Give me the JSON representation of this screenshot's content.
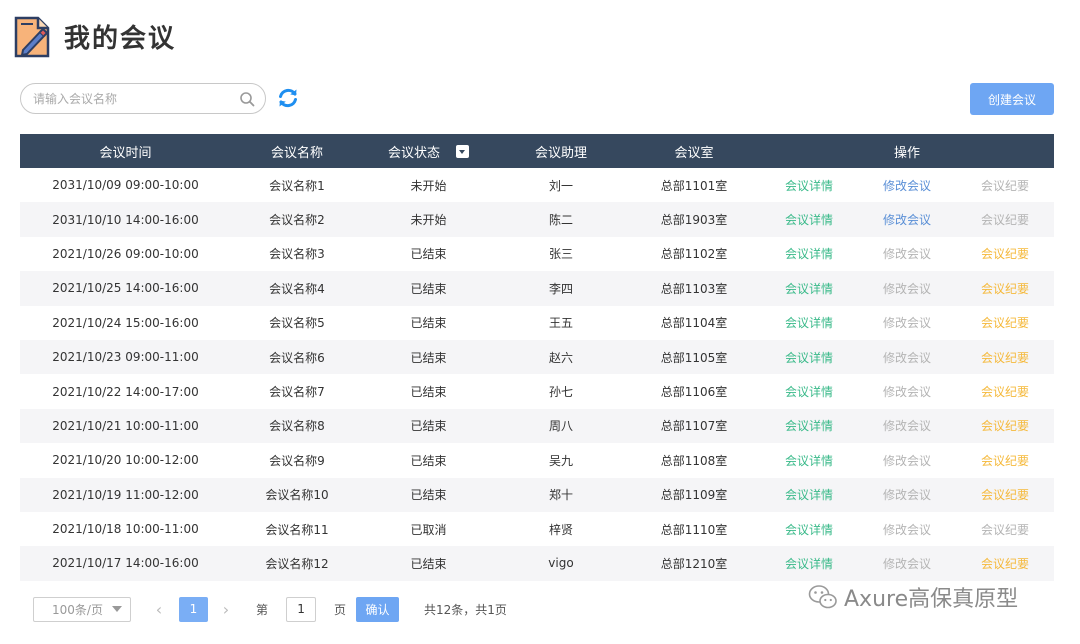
{
  "page": {
    "title": "我的会议"
  },
  "search": {
    "placeholder": "请输入会议名称"
  },
  "actions": {
    "create_label": "创建会议"
  },
  "colors": {
    "header_bg": "#36485e",
    "link_green": "#3aba8a",
    "link_blue": "#5a8fd6",
    "link_gray": "#b4b4b4",
    "link_orange": "#f5b93b",
    "primary": "#6ea6f3"
  },
  "table": {
    "headers": [
      "会议时间",
      "会议名称",
      "会议状态",
      "会议助理",
      "会议室",
      "操作"
    ],
    "rows": [
      {
        "time": "2031/10/09 09:00-10:00",
        "name": "会议名称1",
        "status": "未开始",
        "assistant": "刘一",
        "room": "总部1101室",
        "detail": "会议详情",
        "detail_state": "green",
        "edit": "修改会议",
        "edit_state": "blue",
        "minutes": "会议纪要",
        "minutes_state": "gray"
      },
      {
        "time": "2031/10/10 14:00-16:00",
        "name": "会议名称2",
        "status": "未开始",
        "assistant": "陈二",
        "room": "总部1903室",
        "detail": "会议详情",
        "detail_state": "green",
        "edit": "修改会议",
        "edit_state": "blue",
        "minutes": "会议纪要",
        "minutes_state": "gray"
      },
      {
        "time": "2021/10/26 09:00-10:00",
        "name": "会议名称3",
        "status": "已结束",
        "assistant": "张三",
        "room": "总部1102室",
        "detail": "会议详情",
        "detail_state": "green",
        "edit": "修改会议",
        "edit_state": "gray",
        "minutes": "会议纪要",
        "minutes_state": "orange"
      },
      {
        "time": "2021/10/25 14:00-16:00",
        "name": "会议名称4",
        "status": "已结束",
        "assistant": "李四",
        "room": "总部1103室",
        "detail": "会议详情",
        "detail_state": "green",
        "edit": "修改会议",
        "edit_state": "gray",
        "minutes": "会议纪要",
        "minutes_state": "orange"
      },
      {
        "time": "2021/10/24 15:00-16:00",
        "name": "会议名称5",
        "status": "已结束",
        "assistant": "王五",
        "room": "总部1104室",
        "detail": "会议详情",
        "detail_state": "green",
        "edit": "修改会议",
        "edit_state": "gray",
        "minutes": "会议纪要",
        "minutes_state": "orange"
      },
      {
        "time": "2021/10/23 09:00-11:00",
        "name": "会议名称6",
        "status": "已结束",
        "assistant": "赵六",
        "room": "总部1105室",
        "detail": "会议详情",
        "detail_state": "green",
        "edit": "修改会议",
        "edit_state": "gray",
        "minutes": "会议纪要",
        "minutes_state": "orange"
      },
      {
        "time": "2021/10/22 14:00-17:00",
        "name": "会议名称7",
        "status": "已结束",
        "assistant": "孙七",
        "room": "总部1106室",
        "detail": "会议详情",
        "detail_state": "green",
        "edit": "修改会议",
        "edit_state": "gray",
        "minutes": "会议纪要",
        "minutes_state": "orange"
      },
      {
        "time": "2021/10/21 10:00-11:00",
        "name": "会议名称8",
        "status": "已结束",
        "assistant": "周八",
        "room": "总部1107室",
        "detail": "会议详情",
        "detail_state": "green",
        "edit": "修改会议",
        "edit_state": "gray",
        "minutes": "会议纪要",
        "minutes_state": "orange"
      },
      {
        "time": "2021/10/20 10:00-12:00",
        "name": "会议名称9",
        "status": "已结束",
        "assistant": "吴九",
        "room": "总部1108室",
        "detail": "会议详情",
        "detail_state": "green",
        "edit": "修改会议",
        "edit_state": "gray",
        "minutes": "会议纪要",
        "minutes_state": "orange"
      },
      {
        "time": "2021/10/19 11:00-12:00",
        "name": "会议名称10",
        "status": "已结束",
        "assistant": "郑十",
        "room": "总部1109室",
        "detail": "会议详情",
        "detail_state": "green",
        "edit": "修改会议",
        "edit_state": "gray",
        "minutes": "会议纪要",
        "minutes_state": "orange"
      },
      {
        "time": "2021/10/18 10:00-11:00",
        "name": "会议名称11",
        "status": "已取消",
        "assistant": "梓贤",
        "room": "总部1110室",
        "detail": "会议详情",
        "detail_state": "green",
        "edit": "修改会议",
        "edit_state": "gray",
        "minutes": "会议纪要",
        "minutes_state": "gray"
      },
      {
        "time": "2021/10/17 14:00-16:00",
        "name": "会议名称12",
        "status": "已结束",
        "assistant": "vigo",
        "room": "总部1210室",
        "detail": "会议详情",
        "detail_state": "green",
        "edit": "修改会议",
        "edit_state": "gray",
        "minutes": "会议纪要",
        "minutes_state": "orange"
      }
    ]
  },
  "pagination": {
    "page_size": "100条/页",
    "prev": "‹",
    "current_page": "1",
    "next": "›",
    "goto_prefix": "第",
    "goto_value": "1",
    "goto_suffix": "页",
    "confirm_label": "确认",
    "total": "共12条，共1页"
  },
  "watermark": {
    "text": "Axure高保真原型"
  }
}
